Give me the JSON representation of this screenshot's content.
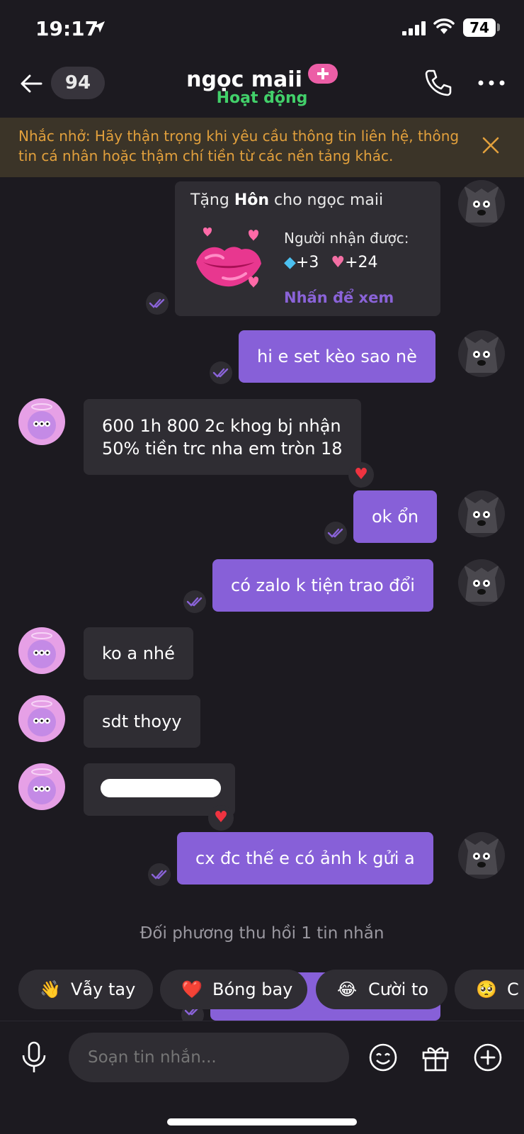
{
  "status_bar": {
    "time": "19:17",
    "battery": "74"
  },
  "header": {
    "unread_count": "94",
    "contact_name": "ngọc maii",
    "status": "Hoạt động"
  },
  "banner": {
    "text": "Nhắc nhở: Hãy thận trọng khi yêu cầu thông tin liên hệ, thông tin cá nhân hoặc thậm chí tiền từ các nền tảng khác."
  },
  "gift_card": {
    "prefix": "Tặng",
    "gift_name": "Hôn",
    "suffix": "cho ngọc maii",
    "receiver_label": "Người nhận được:",
    "diamonds": "+3",
    "hearts": "+24",
    "view_label": "Nhấn để xem"
  },
  "messages": [
    {
      "direction": "out",
      "text": "hi e set kèo sao nè"
    },
    {
      "direction": "in",
      "text": "600 1h 800 2c khog bj nhận\n50% tiền trc nha em tròn 18",
      "reaction": "heart"
    },
    {
      "direction": "out",
      "text": "ok ổn"
    },
    {
      "direction": "out",
      "text": "có zalo k tiện trao đổi"
    },
    {
      "direction": "in",
      "text": "ko a nhé"
    },
    {
      "direction": "in",
      "text": "sdt thoyy"
    },
    {
      "direction": "in",
      "text": "",
      "redacted": true,
      "reaction": "heart"
    },
    {
      "direction": "out",
      "text": "cx đc thế e có ảnh k gửi a"
    }
  ],
  "system_notice": "Đối phương thu hồi 1 tin nhắn",
  "quick_replies": [
    {
      "emoji": "👋",
      "label": "Vẫy tay"
    },
    {
      "emoji": "❤️",
      "label": "Bóng bay"
    },
    {
      "emoji": "😂",
      "label": "Cười to"
    },
    {
      "emoji": "🥺",
      "label": "C"
    }
  ],
  "composer": {
    "placeholder": "Soạn tin nhắn..."
  },
  "colors": {
    "background": "#1c1a20",
    "outgoing_bubble": "#8760d8",
    "incoming_bubble": "#2f2d33",
    "online_status": "#42d06a",
    "banner_text": "#e2a03c",
    "accent_badge": "#ec5ea6"
  },
  "icons": [
    "back-arrow-icon",
    "location-arrow-icon",
    "signal-icon",
    "wifi-icon",
    "phone-icon",
    "more-dots-icon",
    "close-icon",
    "read-check-icon",
    "heart-reaction-icon",
    "mic-icon",
    "emoji-icon",
    "gift-icon",
    "add-icon"
  ]
}
